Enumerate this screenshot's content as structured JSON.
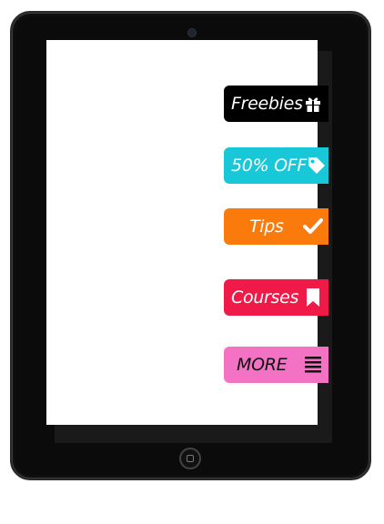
{
  "menu": {
    "items": [
      {
        "id": "freebies",
        "label": "Freebies",
        "icon": "gift-icon",
        "bg": "#000000",
        "fg": "#ffffff"
      },
      {
        "id": "discount",
        "label": "50% OFF",
        "icon": "tag-icon",
        "bg": "#19c8d8",
        "fg": "#ffffff"
      },
      {
        "id": "tips",
        "label": "Tips",
        "icon": "checkmark-icon",
        "bg": "#fb7a0c",
        "fg": "#ffffff"
      },
      {
        "id": "courses",
        "label": "Courses",
        "icon": "bookmark-icon",
        "bg": "#f01a48",
        "fg": "#ffffff"
      },
      {
        "id": "more",
        "label": "MORE",
        "icon": "hamburger-menu-icon",
        "bg": "#f472c4",
        "fg": "#111111"
      }
    ]
  },
  "device": {
    "frame_color": "#0b0b0b",
    "screen_color": "#ffffff"
  }
}
